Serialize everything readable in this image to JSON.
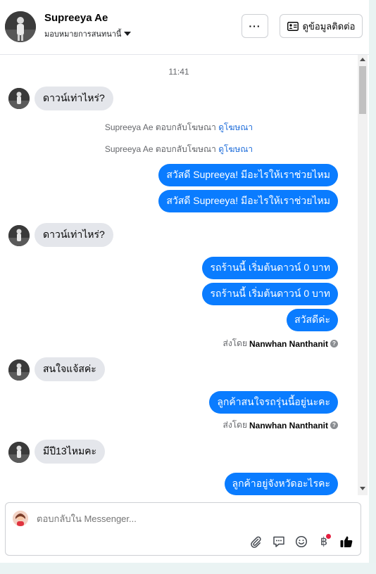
{
  "header": {
    "contact_name": "Supreeya Ae",
    "assign_label": "มอบหมายการสนทนานี้",
    "more_label": "···",
    "view_contact_label": "ดูข้อมูลติดต่อ"
  },
  "chat": {
    "timestamp": "11:41",
    "messages": [
      {
        "type": "in",
        "text": "ดาวน์เท่าไหร่?"
      },
      {
        "type": "sys",
        "text": "Supreeya Ae ตอบกลับโฆษณา",
        "link": "ดูโฆษณา"
      },
      {
        "type": "sys",
        "text": "Supreeya Ae ตอบกลับโฆษณา",
        "link": "ดูโฆษณา"
      },
      {
        "type": "out",
        "text": "สวัสดี Supreeya! มีอะไรให้เราช่วยไหม"
      },
      {
        "type": "out",
        "text": "สวัสดี Supreeya! มีอะไรให้เราช่วยไหม"
      },
      {
        "type": "in",
        "text": "ดาวน์เท่าไหร่?"
      },
      {
        "type": "out",
        "text": "รถร้านนี้ เริ่มต้นดาวน์ 0 บาท"
      },
      {
        "type": "out",
        "text": "รถร้านนี้ เริ่มต้นดาวน์ 0 บาท"
      },
      {
        "type": "out",
        "text": "สวัสดีค่ะ"
      },
      {
        "type": "sentby",
        "prefix": "ส่งโดย",
        "name": "Nanwhan Nanthanit"
      },
      {
        "type": "in",
        "text": "สนใจแจ้สค่ะ"
      },
      {
        "type": "out",
        "text": "ลูกค้าสนใจรถรุ่นนี้อยู่นะคะ"
      },
      {
        "type": "sentby",
        "prefix": "ส่งโดย",
        "name": "Nanwhan Nanthanit"
      },
      {
        "type": "in",
        "text": "มีปี13ไหมคะ"
      },
      {
        "type": "out",
        "text": "ลูกค้าอยู่จังหวัดอะไรคะ"
      }
    ]
  },
  "composer": {
    "placeholder": "ตอบกลับใน Messenger...",
    "icons": [
      "paperclip-icon",
      "chat-bubble-icon",
      "emoji-icon",
      "baht-icon",
      "thumbs-up-icon"
    ]
  },
  "colors": {
    "outgoing_bubble": "#0a7cff",
    "incoming_bubble": "#e4e6eb",
    "link": "#216fdb"
  }
}
